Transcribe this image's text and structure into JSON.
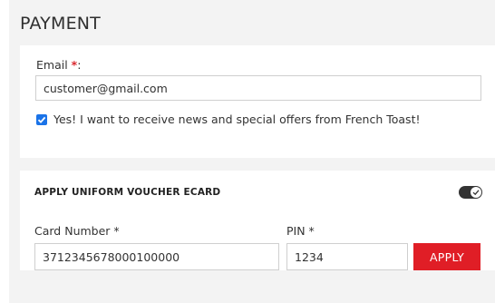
{
  "payment": {
    "title": "PAYMENT",
    "email": {
      "label": "Email ",
      "required_mark": "*",
      "colon": ":",
      "value": "customer@gmail.com"
    },
    "newsletter": {
      "checked": true,
      "label": "Yes! I want to receive news and special offers from French Toast!"
    }
  },
  "voucher": {
    "title": "APPLY UNIFORM VOUCHER ECARD",
    "toggle_on": true,
    "card_number": {
      "label": "Card Number *",
      "value": "3712345678000100000"
    },
    "pin": {
      "label": "PIN *",
      "value": "1234"
    },
    "apply_label": "APPLY"
  },
  "colors": {
    "accent_red": "#e01e26",
    "checkbox_blue": "#1a73e8",
    "background": "#f3f3f3"
  }
}
